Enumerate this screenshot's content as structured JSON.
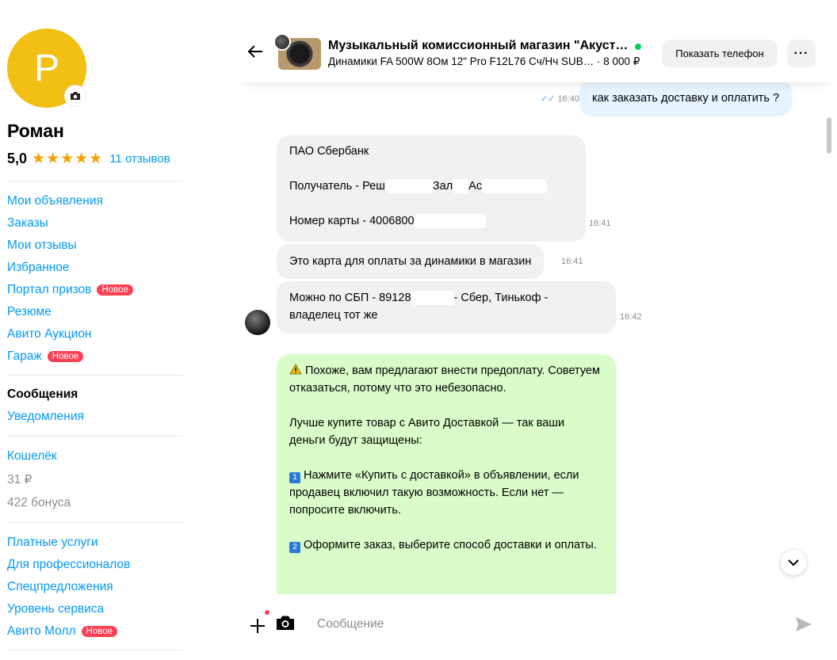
{
  "profile": {
    "initial": "Р",
    "name": "Роман",
    "rating": "5,0",
    "stars": "★★★★★",
    "reviews": "11 отзывов"
  },
  "menu": {
    "section1": [
      {
        "label": "Мои объявления"
      },
      {
        "label": "Заказы"
      },
      {
        "label": "Мои отзывы"
      },
      {
        "label": "Избранное"
      },
      {
        "label": "Портал призов",
        "badge": "Новое"
      },
      {
        "label": "Резюме"
      },
      {
        "label": "Авито Аукцион"
      },
      {
        "label": "Гараж",
        "badge": "Новое"
      }
    ],
    "messages": "Сообщения",
    "notifications": "Уведомления",
    "wallet": "Кошелёк",
    "balance": "31 ₽",
    "bonus": "422 бонуса",
    "section4": [
      {
        "label": "Платные услуги"
      },
      {
        "label": "Для профессионалов"
      },
      {
        "label": "Спецпредложения"
      },
      {
        "label": "Уровень сервиса"
      },
      {
        "label": "Авито Молл",
        "badge": "Новое"
      }
    ]
  },
  "header": {
    "title": "Музыкальный комиссионный магазин \"Акуст…",
    "subtitle": "Динамики FA 500W 8Ом 12\" Pro F12L76 Сч/Нч SUB… · 8 000 ₽",
    "phone_button": "Показать телефон",
    "more_button": "···"
  },
  "messages": {
    "out1": {
      "text": "как заказать доставку и оплатить ?",
      "time": "16:40",
      "checks": "✓✓"
    },
    "in1": {
      "line1": "ПАО Сбербанк",
      "line2": "Получатель - Реш",
      "line2b": "Зал",
      "line2c": "Ас",
      "line3": "Номер карты - 4006800",
      "time": "16:41"
    },
    "in2": {
      "text": "Это карта для оплаты за динамики в магазин",
      "time": "16:41"
    },
    "in3": {
      "line1a": "Можно по СБП - 89128",
      "line1b": "- Сбер, Тинькоф -",
      "line2": "владелец тот же",
      "time": "16:42"
    },
    "warning": {
      "p1": "Похоже, вам предлагают внести предоплату. Советуем отказаться, потому что это небезопасно.",
      "p2": "Лучше купите товар с Авито Доставкой — так ваши деньги будут защищены:",
      "s1_num": "1",
      "s1": "Нажмите «Купить с доставкой» в объявлении, если продавец включил такую возможность. Если нет — попросите включить.",
      "s2_num": "2",
      "s2": "Оформите заказ, выберите способ доставки и оплаты."
    }
  },
  "input": {
    "placeholder": "Сообщение"
  }
}
